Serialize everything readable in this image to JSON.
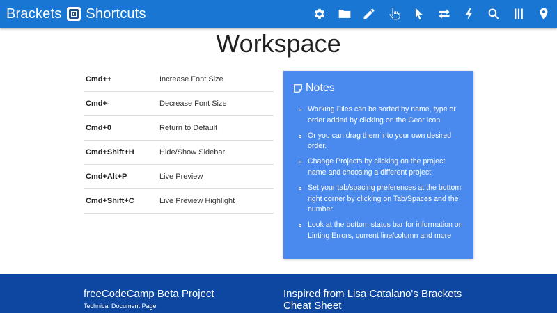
{
  "header": {
    "brand_left": "Brackets",
    "brand_right": "Shortcuts",
    "icons": [
      "gear-icon",
      "folder-icon",
      "pencil-icon",
      "hand-pointer-icon",
      "cursor-arrow-icon",
      "exchange-icon",
      "lightning-icon",
      "search-icon",
      "columns-icon",
      "map-marker-icon"
    ]
  },
  "page": {
    "title": "Workspace"
  },
  "shortcuts": [
    {
      "key": "Cmd++",
      "desc": "Increase Font Size"
    },
    {
      "key": "Cmd+-",
      "desc": "Decrease Font Size"
    },
    {
      "key": "Cmd+0",
      "desc": "Return to Default"
    },
    {
      "key": "Cmd+Shift+H",
      "desc": "Hide/Show Sidebar"
    },
    {
      "key": "Cmd+Alt+P",
      "desc": "Live Preview"
    },
    {
      "key": "Cmd+Shift+C",
      "desc": "Live Preview Highlight"
    }
  ],
  "notes": {
    "title": "Notes",
    "items": [
      "Working Files can be sorted by name, type or order added by clicking on the Gear icon",
      "Or you can drag them into your own desired order.",
      "Change Projects by clicking on the project name and choosing a different project",
      "Set your tab/spacing preferences at the bottom right corner by clicking on Tab/Spaces and the number",
      "Look at the bottom status bar for information on Linting Errors, current line/column and more"
    ]
  },
  "footer": {
    "left_title": "freeCodeCamp Beta Project",
    "left_subtitle": "Technical Document Page",
    "right_title": "Inspired from Lisa Catalano's Brackets Cheat Sheet"
  },
  "colors": {
    "header_bg": "#1976d2",
    "notes_bg": "#4a89ee",
    "footer_bg": "#0d47a1"
  }
}
